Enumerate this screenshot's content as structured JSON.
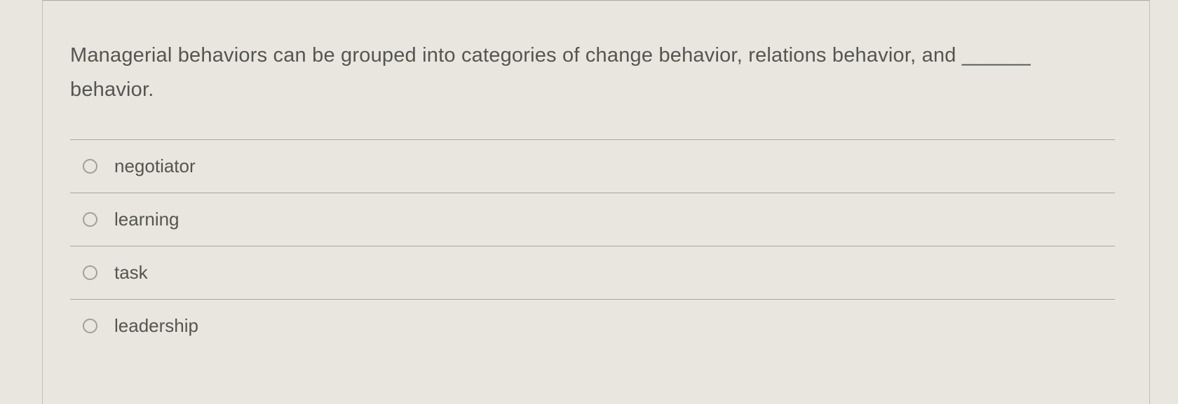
{
  "question": {
    "text": "Managerial behaviors can be grouped into categories of change behavior, relations behavior, and ______ behavior."
  },
  "options": [
    {
      "label": "negotiator"
    },
    {
      "label": "learning"
    },
    {
      "label": "task"
    },
    {
      "label": "leadership"
    }
  ]
}
